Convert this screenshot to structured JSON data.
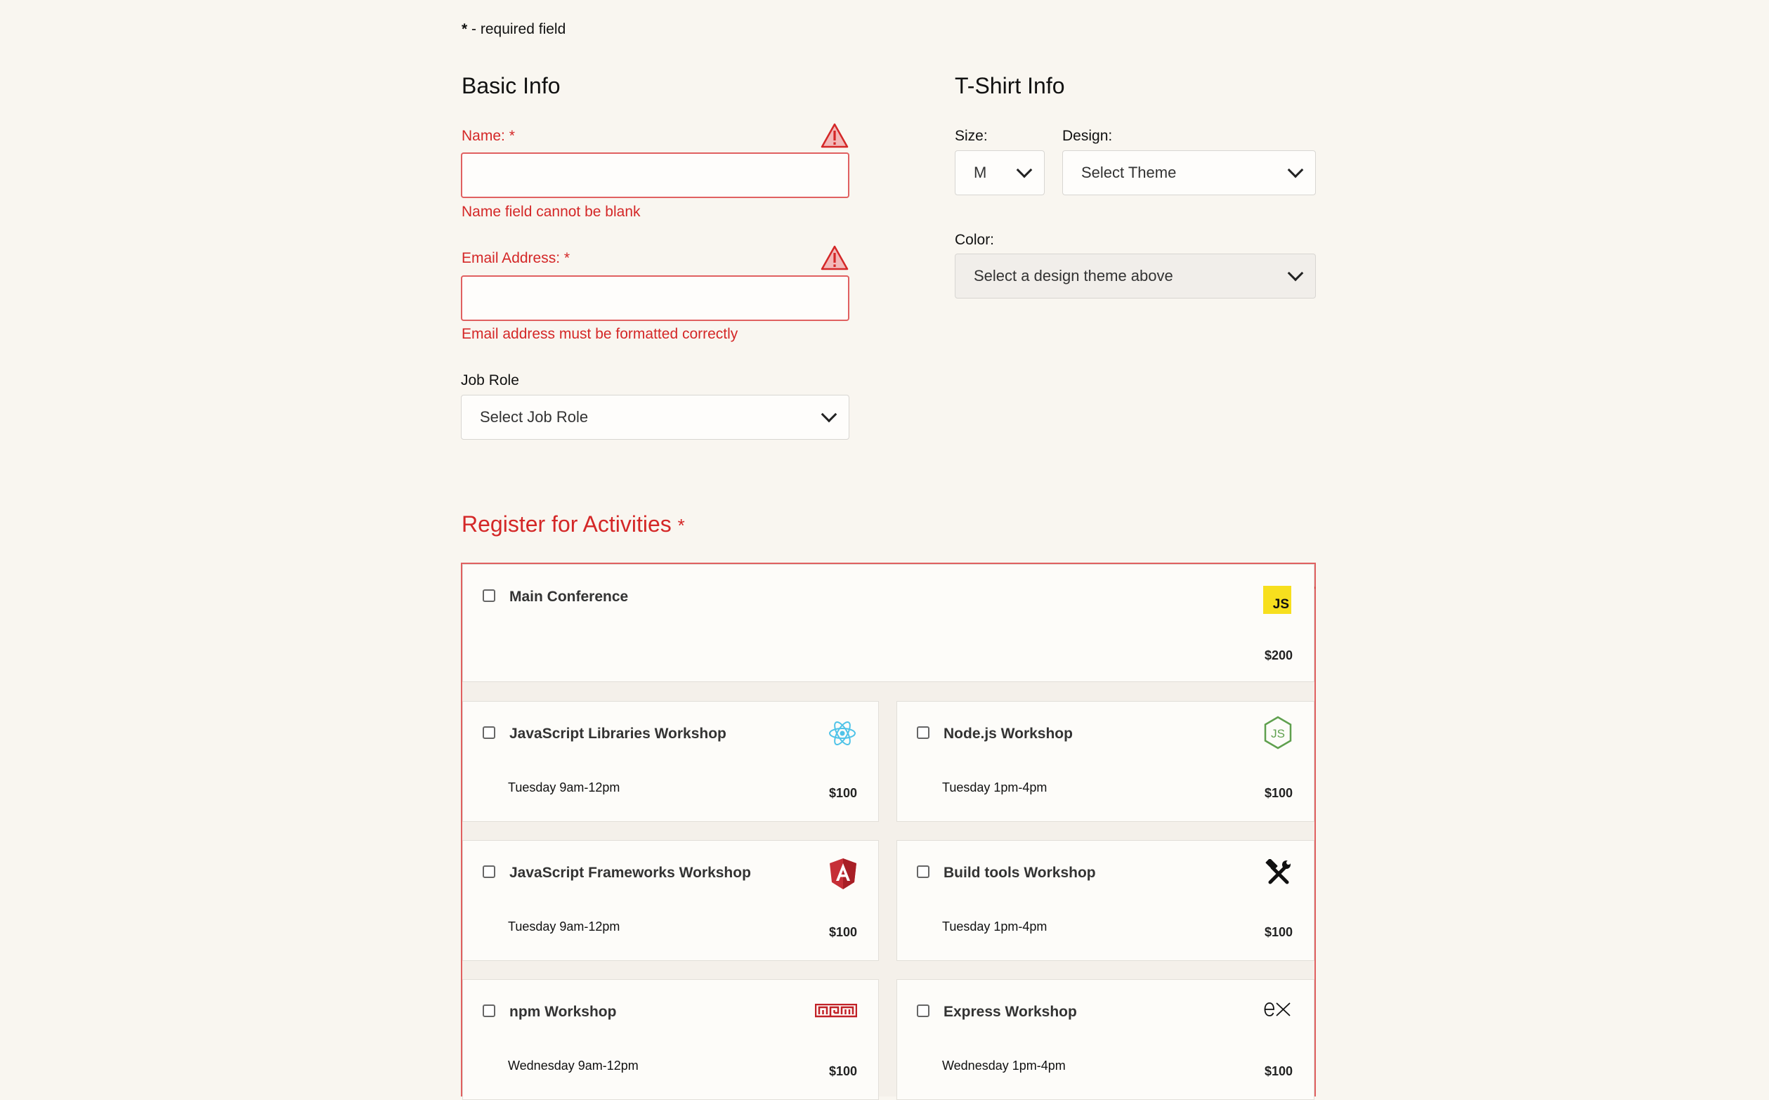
{
  "required_note": {
    "star": "*",
    "text": " - required field"
  },
  "basic_info": {
    "title": "Basic Info",
    "name": {
      "label": "Name:",
      "star": "*",
      "value": "",
      "error": "Name field cannot be blank"
    },
    "email": {
      "label": "Email Address:",
      "star": "*",
      "value": "",
      "error": "Email address must be formatted correctly"
    },
    "job_role": {
      "label": "Job Role",
      "selected": "Select Job Role"
    }
  },
  "tshirt_info": {
    "title": "T-Shirt Info",
    "size": {
      "label": "Size:",
      "selected": "M"
    },
    "design": {
      "label": "Design:",
      "selected": "Select Theme"
    },
    "color": {
      "label": "Color:",
      "selected": "Select a design theme above"
    }
  },
  "activities": {
    "title": "Register for Activities",
    "star": "*",
    "main": {
      "name": "Main Conference",
      "cost": "$200",
      "logo_text": "JS"
    },
    "workshops": [
      {
        "name": "JavaScript Libraries Workshop",
        "time": "Tuesday 9am-12pm",
        "cost": "$100",
        "icon": "react-icon"
      },
      {
        "name": "Node.js Workshop",
        "time": "Tuesday 1pm-4pm",
        "cost": "$100",
        "icon": "nodejs-icon"
      },
      {
        "name": "JavaScript Frameworks Workshop",
        "time": "Tuesday 9am-12pm",
        "cost": "$100",
        "icon": "angular-icon"
      },
      {
        "name": "Build tools Workshop",
        "time": "Tuesday 1pm-4pm",
        "cost": "$100",
        "icon": "hammer-wrench-icon"
      },
      {
        "name": "npm Workshop",
        "time": "Wednesday 9am-12pm",
        "cost": "$100",
        "icon": "npm-icon"
      },
      {
        "name": "Express Workshop",
        "time": "Wednesday 1pm-4pm",
        "cost": "$100",
        "icon": "express-icon"
      }
    ]
  },
  "colors": {
    "error": "#d42727",
    "background": "#f9f6f0",
    "js_yellow": "#f7df1e"
  }
}
